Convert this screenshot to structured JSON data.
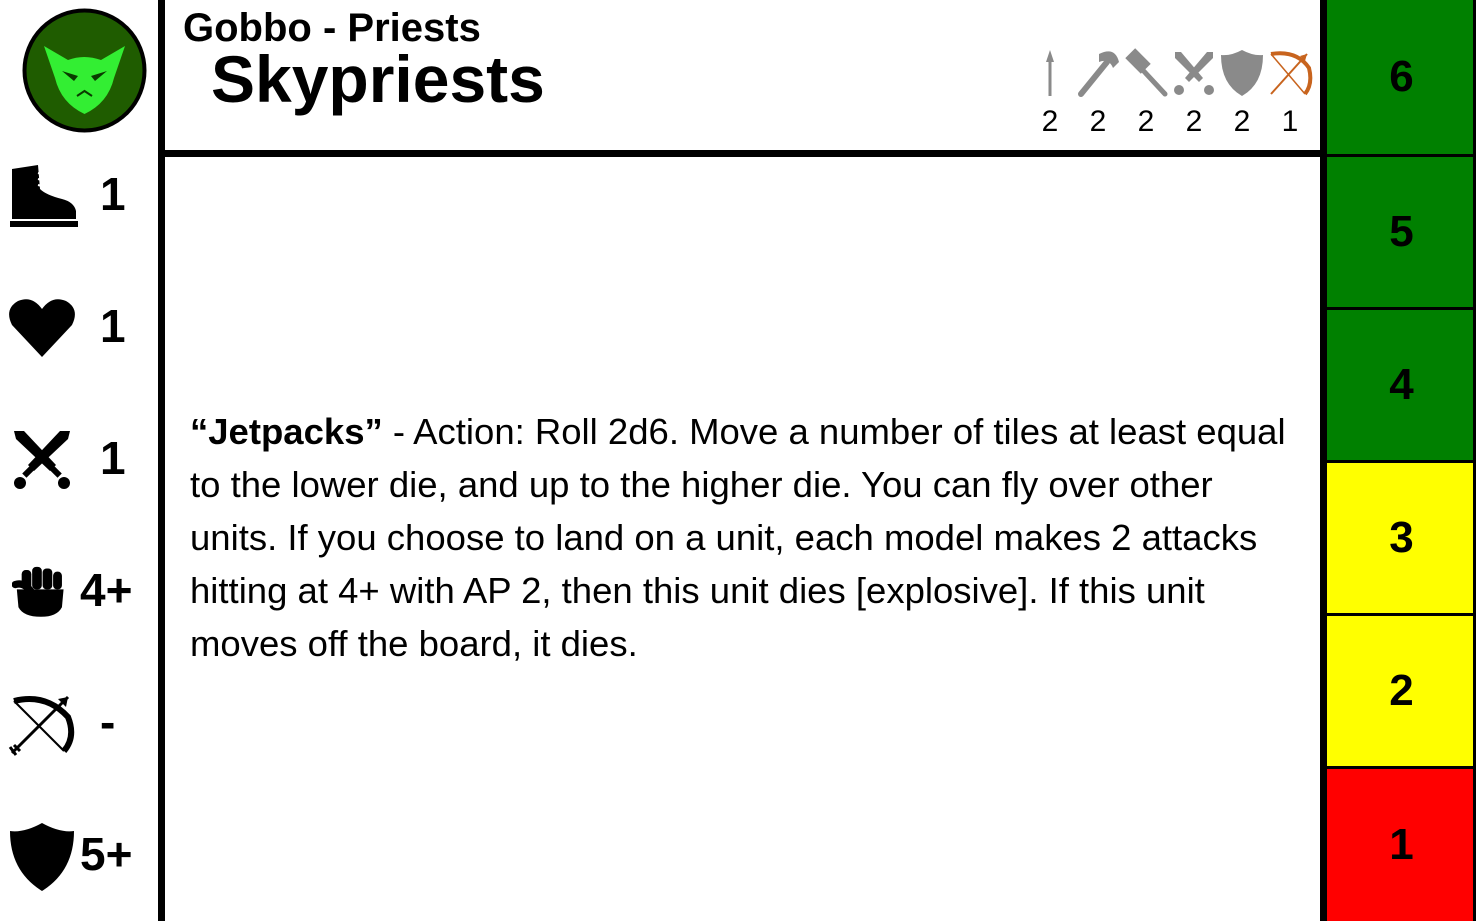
{
  "header": {
    "subtitle": "Gobbo - Priests",
    "title": "Skypriests"
  },
  "weapons": [
    {
      "icon": "spear-icon",
      "count": "2",
      "color": "#8a8a8a"
    },
    {
      "icon": "axe-icon",
      "count": "2",
      "color": "#8a8a8a"
    },
    {
      "icon": "hammer-icon",
      "count": "2",
      "color": "#8a8a8a"
    },
    {
      "icon": "crossed-swords-icon",
      "count": "2",
      "color": "#8a8a8a"
    },
    {
      "icon": "shield-icon",
      "count": "2",
      "color": "#8a8a8a"
    },
    {
      "icon": "bow-icon",
      "count": "1",
      "color": "#c8641e"
    }
  ],
  "stats": [
    {
      "icon": "boot-icon",
      "value": "1"
    },
    {
      "icon": "heart-icon",
      "value": "1"
    },
    {
      "icon": "crossed-swords-icon",
      "value": "1"
    },
    {
      "icon": "fist-icon",
      "value": "4+"
    },
    {
      "icon": "bow-icon",
      "value": "-"
    },
    {
      "icon": "shield-icon",
      "value": "5+"
    }
  ],
  "ability": {
    "name": "“Jetpacks”",
    "text": " - Action: Roll 2d6. Move a number of tiles at least equal to the lower die, and up to the higher die. You can fly over other units. If you choose to land on a unit, each model makes 2 attacks hitting at 4+ with AP 2, then this unit dies [explosive]. If this unit moves off the board, it dies."
  },
  "track": [
    {
      "value": "6",
      "color": "#008000"
    },
    {
      "value": "5",
      "color": "#008000"
    },
    {
      "value": "4",
      "color": "#008000"
    },
    {
      "value": "3",
      "color": "#ffff00"
    },
    {
      "value": "2",
      "color": "#ffff00"
    },
    {
      "value": "1",
      "color": "#ff0000"
    }
  ],
  "colors": {
    "logo_bg": "#1f5c00",
    "logo_face": "#33ee33"
  }
}
